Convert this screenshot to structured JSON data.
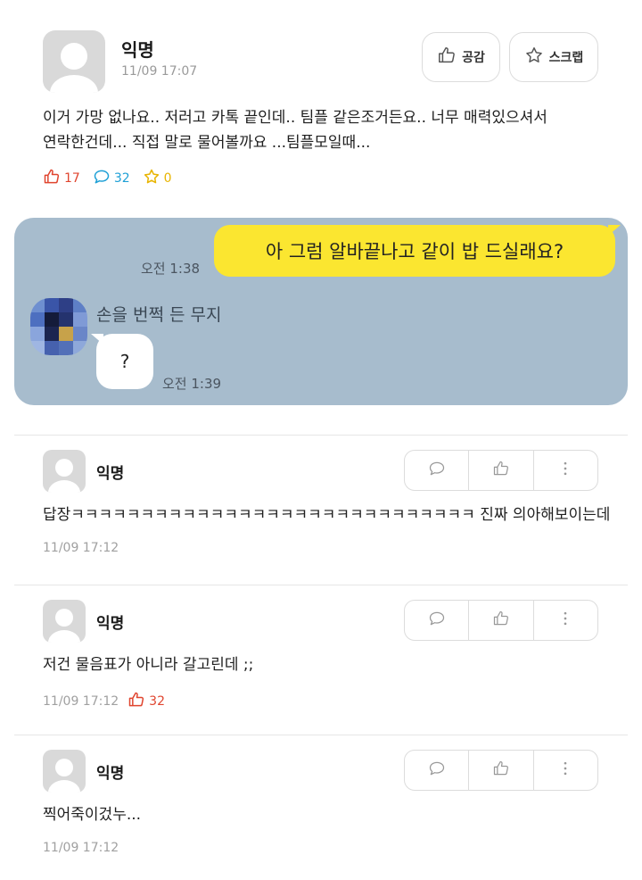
{
  "post": {
    "author": "익명",
    "time": "11/09 17:07",
    "like_button": "공감",
    "scrap_button": "스크랩",
    "body_line1": "이거 가망 없나요.. 저러고 카톡 끝인데.. 팀플 같은조거든요.. 너무 매력있으셔서",
    "body_line2": "연락한건데... 직접 말로 물어볼까요 ...팀플모일때...",
    "likes": "17",
    "comments": "32",
    "scraps": "0"
  },
  "chat": {
    "my_message": "아 그럼 알바끝나고 같이 밥 드실래요?",
    "my_time": "오전 1:38",
    "other_name": "손을 번쩍 든 무지",
    "other_message": "?",
    "other_time": "오전 1:39"
  },
  "comments": [
    {
      "author": "익명",
      "text": "답장ㅋㅋㅋㅋㅋㅋㅋㅋㅋㅋㅋㅋㅋㅋㅋㅋㅋㅋㅋㅋㅋㅋㅋㅋㅋㅋㅋㅋㅋ 진짜 의아해보이는데",
      "time": "11/09 17:12",
      "likes": ""
    },
    {
      "author": "익명",
      "text": "저건 물음표가 아니라 갈고린데 ;;",
      "time": "11/09 17:12",
      "likes": "32"
    },
    {
      "author": "익명",
      "text": "찍어죽이겄누...",
      "time": "11/09 17:12",
      "likes": ""
    }
  ],
  "colors": {
    "accent_like": "#e0452f",
    "accent_comment": "#1fa0d6",
    "accent_scrap": "#e8b400",
    "chat_bg": "#a7bccd",
    "my_bubble": "#fbe630"
  },
  "icons": [
    "thumbs-up-icon",
    "star-icon",
    "speech-bubble-icon",
    "more-vertical-icon"
  ]
}
